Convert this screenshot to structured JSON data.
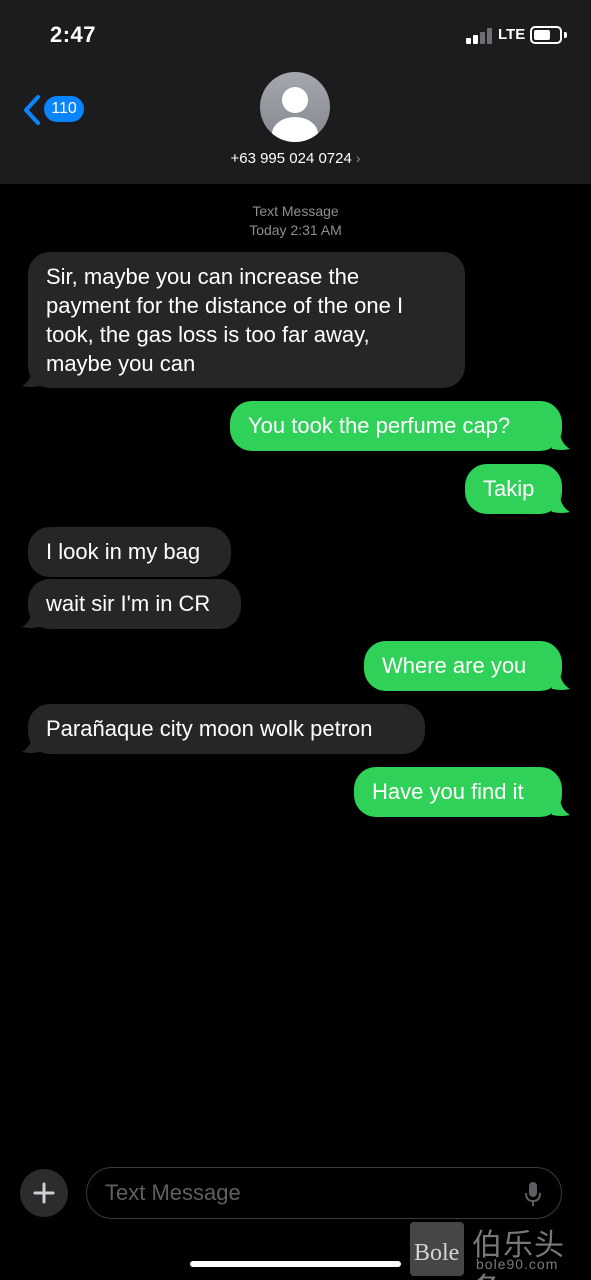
{
  "status_bar": {
    "time": "2:47",
    "network": "LTE"
  },
  "header": {
    "back_badge": "110",
    "contact": "+63 995 024 0724"
  },
  "thread": {
    "meta_label": "Text Message",
    "meta_time": "Today 2:31 AM",
    "messages": [
      {
        "dir": "in",
        "text": "Sir, maybe you can increase the"
      },
      {
        "dir": "in",
        "text": "payment for the distance of the one I"
      },
      {
        "dir": "in",
        "text": "took, the gas loss is too far away,"
      },
      {
        "dir": "in",
        "text": "maybe you can"
      },
      {
        "dir": "out",
        "text": "You took the perfume cap?"
      },
      {
        "dir": "out",
        "text": "Takip"
      },
      {
        "dir": "in",
        "text": "I look in my bag"
      },
      {
        "dir": "in",
        "text": "wait sir I'm in CR"
      },
      {
        "dir": "out",
        "text": "Where are you"
      },
      {
        "dir": "in",
        "text": "Parañaque city moon wolk petron"
      },
      {
        "dir": "out",
        "text": "Have you find it"
      }
    ]
  },
  "composer": {
    "placeholder": "Text Message"
  },
  "watermark": {
    "logo": "Bole",
    "chinese": "伯乐头条",
    "url": "bole90.com"
  },
  "colors": {
    "incoming": "#262628",
    "outgoing": "#30d158",
    "accent": "#0a84ff"
  }
}
